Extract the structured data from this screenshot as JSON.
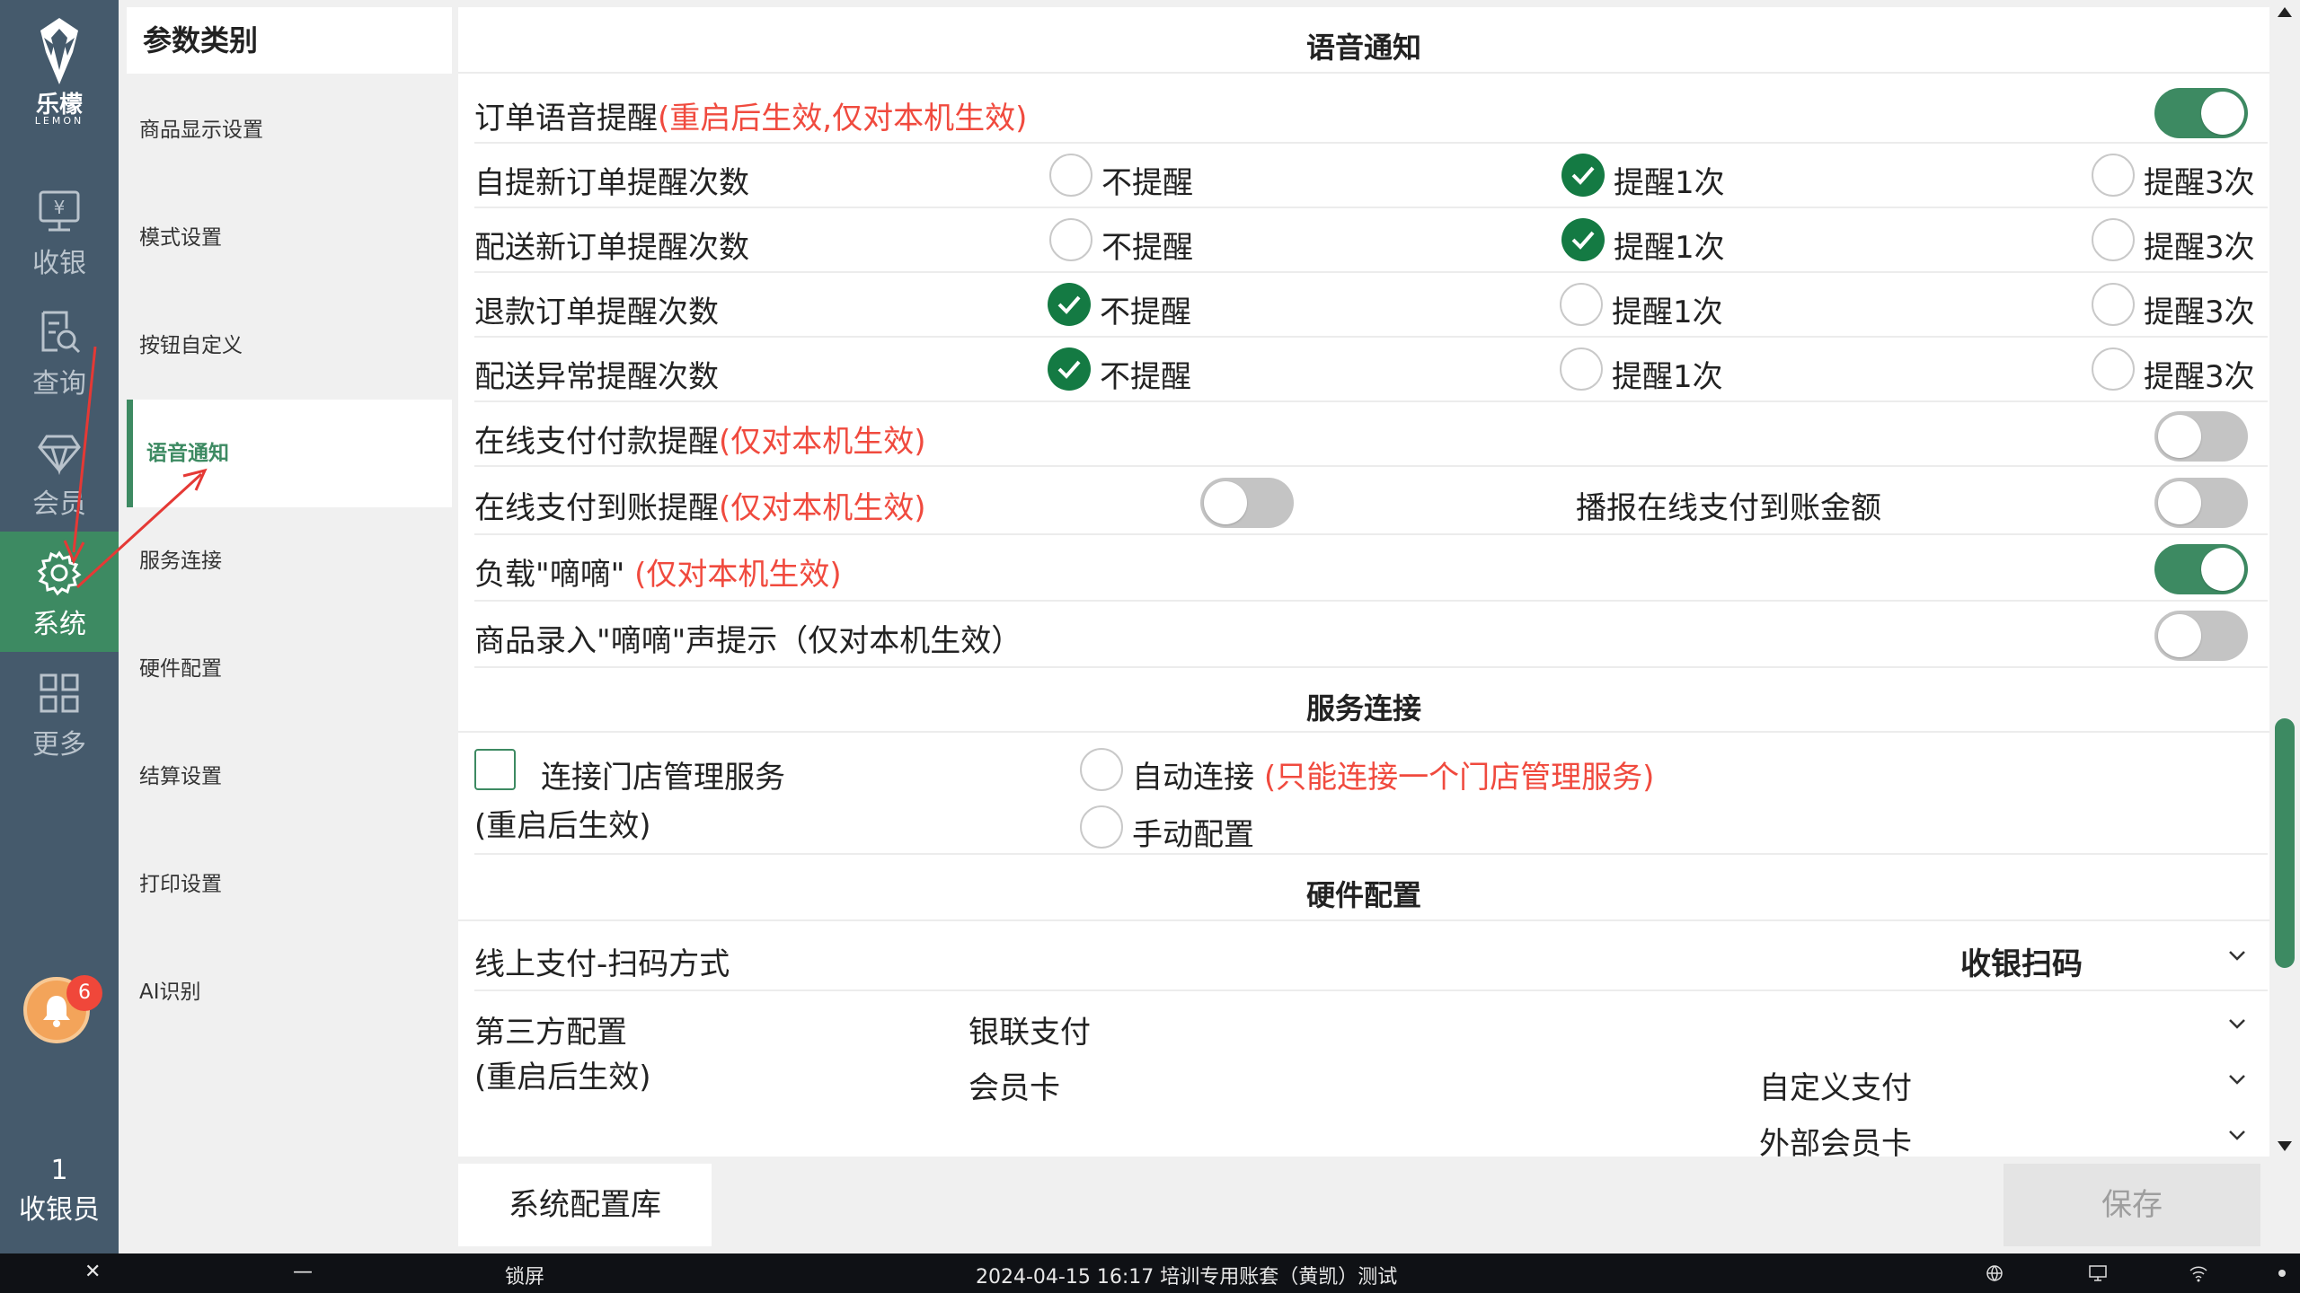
{
  "brand": {
    "name": "乐檬",
    "sub": "LEMON"
  },
  "nav": [
    {
      "label": "收银",
      "icon": "cash-register-icon"
    },
    {
      "label": "查询",
      "icon": "search-doc-icon"
    },
    {
      "label": "会员",
      "icon": "diamond-icon"
    },
    {
      "label": "系统",
      "icon": "gear-icon",
      "active": true
    },
    {
      "label": "更多",
      "icon": "grid-icon"
    }
  ],
  "notifications": {
    "count": "6"
  },
  "cashier": {
    "num": "1",
    "label": "收银员"
  },
  "categories": {
    "title": "参数类别",
    "items": [
      "商品显示设置",
      "模式设置",
      "按钮自定义",
      "语音通知",
      "服务连接",
      "硬件配置",
      "结算设置",
      "打印设置",
      "AI识别"
    ],
    "active": "语音通知"
  },
  "voice": {
    "title": "语音通知",
    "order_voice": {
      "label": "订单语音提醒",
      "note": "(重启后生效,仅对本机生效)",
      "on": true
    },
    "options": [
      "不提醒",
      "提醒1次",
      "提醒3次"
    ],
    "rows": [
      {
        "label": "自提新订单提醒次数",
        "selected": 1
      },
      {
        "label": "配送新订单提醒次数",
        "selected": 1
      },
      {
        "label": "退款订单提醒次数",
        "selected": 0
      },
      {
        "label": "配送异常提醒次数",
        "selected": 0
      }
    ],
    "online_pay": {
      "label": "在线支付付款提醒",
      "note": "(仅对本机生效)",
      "on": false
    },
    "online_arrive": {
      "label": "在线支付到账提醒",
      "note": "(仅对本机生效)",
      "on": false
    },
    "broadcast_amount": {
      "label": "播报在线支付到账金额",
      "on": false
    },
    "beep": {
      "label": "负载\"嘀嘀\"",
      "note": "(仅对本机生效)",
      "on": true
    },
    "entry_beep": {
      "label": "商品录入\"嘀嘀\"声提示（仅对本机生效）",
      "on": false
    }
  },
  "service": {
    "title": "服务连接",
    "connect_label": "连接门店管理服务",
    "restart_note": "(重启后生效)",
    "auto": "自动连接",
    "auto_note": "(只能连接一个门店管理服务)",
    "manual": "手动配置"
  },
  "hardware": {
    "title": "硬件配置",
    "scan_label": "线上支付-扫码方式",
    "scan_value": "收银扫码",
    "third_label": "第三方配置",
    "third_note": "(重启后生效)",
    "unionpay": "银联支付",
    "member_card": "会员卡",
    "custom_pay": "自定义支付",
    "external_card": "外部会员卡"
  },
  "footer": {
    "config_lib": "系统配置库",
    "save": "保存"
  },
  "taskbar": {
    "close": "✕",
    "minimize": "—",
    "lock": "锁屏",
    "status": "2024-04-15 16:17 培训专用账套（黄凯）测试"
  },
  "colors": {
    "accent": "#3d8a62",
    "check": "#147a43",
    "warn": "#f04a3e",
    "rail": "#455a6c"
  }
}
